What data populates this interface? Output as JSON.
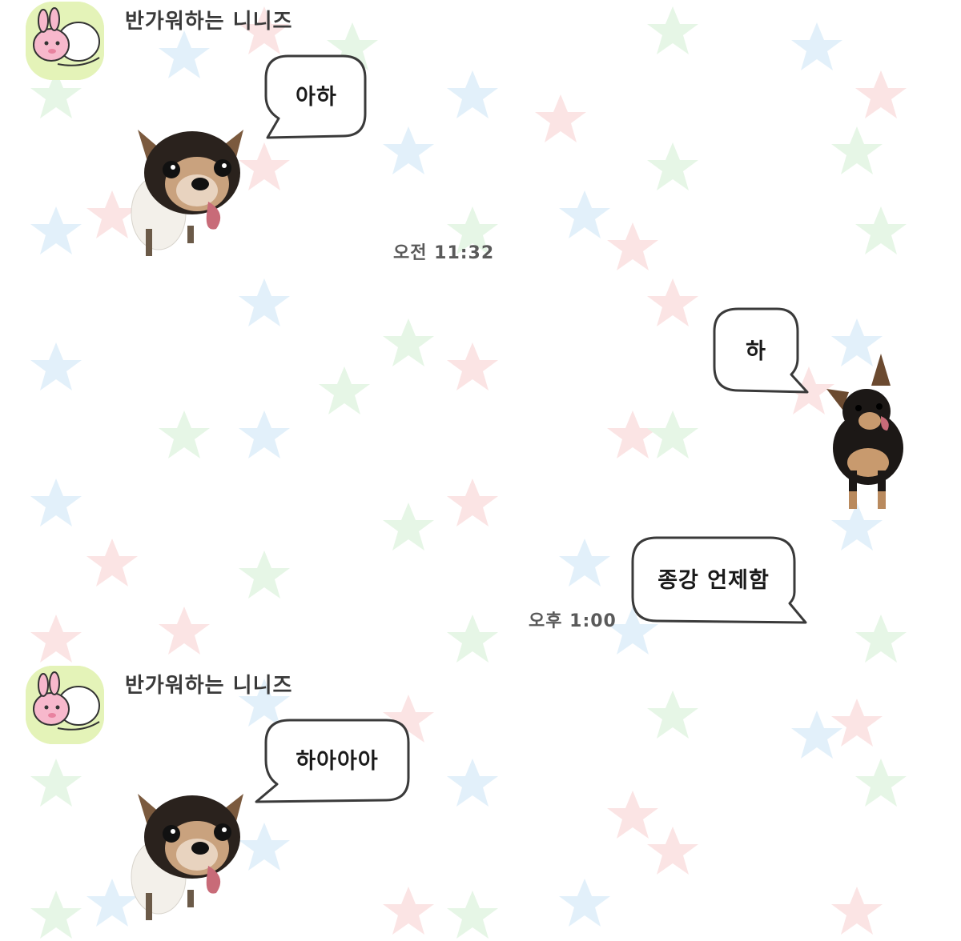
{
  "background": {
    "color": "#ffffff",
    "star_colors": [
      "#e6f6e6",
      "#e2f0fa",
      "#fbe4e4"
    ]
  },
  "messages": [
    {
      "type": "received",
      "sender": "반가워하는 니니즈",
      "avatar_icon": "bunny-avatar-icon",
      "bubble_text": "아하",
      "sticker_icon": "chihuahua-face-sticker-icon",
      "time": "오전 11:32"
    },
    {
      "type": "sent",
      "bubble_text": "하",
      "sticker_icon": "chihuahua-standing-sticker-icon"
    },
    {
      "type": "sent",
      "bubble_text": "종강 언제함",
      "time": "오후 1:00"
    },
    {
      "type": "received",
      "sender": "반가워하는 니니즈",
      "avatar_icon": "bunny-avatar-icon",
      "bubble_text": "하아아아",
      "sticker_icon": "chihuahua-face-sticker-icon"
    }
  ],
  "colors": {
    "bubble_border": "#3a3a3a",
    "bubble_fill": "#ffffff",
    "timestamp_text": "#5a5a5a",
    "sender_text": "#3a3a3a",
    "avatar_bg": "#e4f3b8"
  }
}
